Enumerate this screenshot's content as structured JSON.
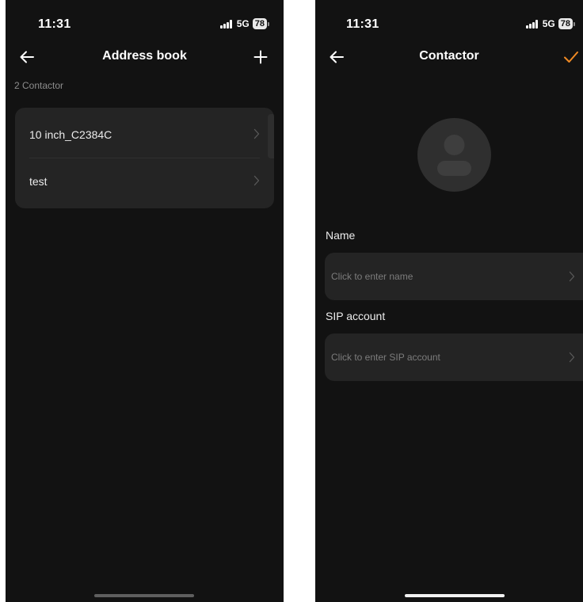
{
  "screens": {
    "address_book": {
      "status_bar": {
        "time": "11:31",
        "network": "5G",
        "battery": "78"
      },
      "nav": {
        "title": "Address book",
        "back_icon": "arrow-left-icon",
        "add_icon": "plus-icon"
      },
      "count_label": "2 Contactor",
      "contacts": [
        {
          "name": "10 inch_C2384C"
        },
        {
          "name": "test"
        }
      ]
    },
    "contactor": {
      "status_bar": {
        "time": "11:31",
        "network": "5G",
        "battery": "78"
      },
      "nav": {
        "title": "Contactor",
        "back_icon": "arrow-left-icon",
        "confirm_icon": "checkmark-icon"
      },
      "avatar_icon": "person-silhouette-icon",
      "name_field": {
        "label": "Name",
        "placeholder": "Click to enter name"
      },
      "sip_field": {
        "label": "SIP account",
        "placeholder": "Click to enter SIP account"
      }
    }
  },
  "colors": {
    "background": "#121212",
    "card": "#242424",
    "accent": "#f08a24",
    "text_primary": "#ececec",
    "text_secondary": "#8d8d8d"
  }
}
